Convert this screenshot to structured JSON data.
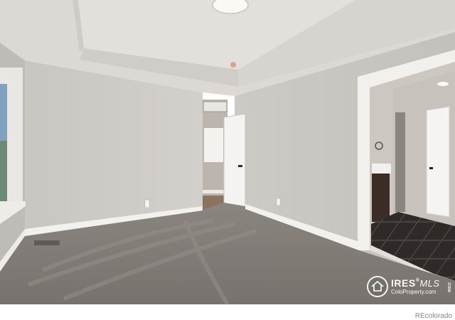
{
  "photo": {
    "subject": "empty-bedroom-interior",
    "watermark": {
      "brand": "IRES",
      "brand_suffix": "MLS",
      "registered_mark": "®",
      "site": "ColoProperty.com",
      "side_text": "IRES"
    }
  },
  "footer": {
    "credit": "REcolorado"
  }
}
